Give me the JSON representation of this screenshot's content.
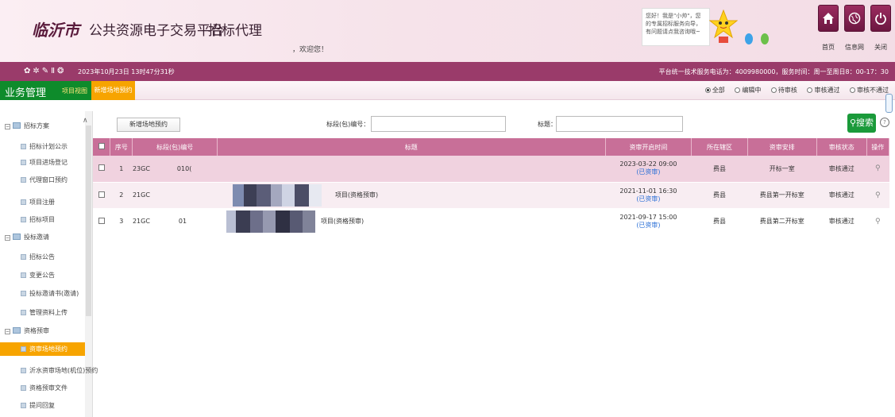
{
  "header": {
    "city": "临沂市",
    "platform": "公共资源电子交易平台",
    "role": "招标代理",
    "welcome": "，欢迎您！",
    "assistant": "您好！我是\"小帅\"，您的专属招标服务向导，有问题请点我咨询哦~",
    "buttons": [
      {
        "label": "首页",
        "icon": "home-icon"
      },
      {
        "label": "信息网",
        "icon": "globe-icon"
      },
      {
        "label": "关闭",
        "icon": "power-icon"
      }
    ]
  },
  "infobar": {
    "datetime": "2023年10月23日 13时47分31秒",
    "hotline": "平台统一技术服务电话为：4009980000，服务时间：周一至周日8：00-17：30"
  },
  "tabbar": {
    "title": "业务管理",
    "project_view": "项目视图",
    "active_tab": "新增场地预约",
    "filters": [
      {
        "label": "全部",
        "checked": true
      },
      {
        "label": "编辑中",
        "checked": false
      },
      {
        "label": "待审核",
        "checked": false
      },
      {
        "label": "审核通过",
        "checked": false
      },
      {
        "label": "审核不通过",
        "checked": false
      }
    ]
  },
  "sidebar": {
    "groups": [
      {
        "label": "招标方案",
        "items": [
          "招标计划公示",
          "项目进场登记",
          "代理窗口预约",
          "项目注册",
          "招标项目"
        ]
      },
      {
        "label": "投标邀请",
        "items": [
          "招标公告",
          "变更公告",
          "投标邀请书(邀请)",
          "管理资料上传"
        ]
      },
      {
        "label": "资格预审",
        "items": [
          "资审场地预约",
          "沂水资审场地(机位)预约",
          "资格预审文件",
          "提问回复"
        ]
      }
    ],
    "active": "资审场地预约"
  },
  "toolbar": {
    "new_button": "新增场地预约",
    "section_label": "标段(包)编号：",
    "title_label": "标题：",
    "search_button": "搜索",
    "help": "?"
  },
  "table": {
    "headers": [
      "序号",
      "标段(包)编号",
      "标题",
      "资审开启时间",
      "所在辖区",
      "资审安排",
      "审核状态",
      "操作"
    ],
    "rows": [
      {
        "no": "1",
        "code": "23GC",
        "code_tail": "010(",
        "title": "",
        "time": "2023-03-22 09:00",
        "status_tag": "(已资审)",
        "district": "费县",
        "arrangement": "开标一室",
        "audit": "审核通过"
      },
      {
        "no": "2",
        "code": "21GC",
        "code_tail": "",
        "title": "项目(资格预审)",
        "time": "2021-11-01 16:30",
        "status_tag": "(已资审)",
        "district": "费县",
        "arrangement": "费县第一开标室",
        "audit": "审核通过"
      },
      {
        "no": "3",
        "code": "21GC",
        "code_tail": "01",
        "title": "项目(资格预审)",
        "time": "2021-09-17 15:00",
        "status_tag": "(已资审)",
        "district": "费县",
        "arrangement": "费县第二开标室",
        "audit": "审核通过"
      }
    ]
  },
  "colors": {
    "brand": "#9a3b6a",
    "header_row": "#c86f98",
    "active_tab": "#f7a400",
    "biz_green": "#0e8b2b"
  }
}
